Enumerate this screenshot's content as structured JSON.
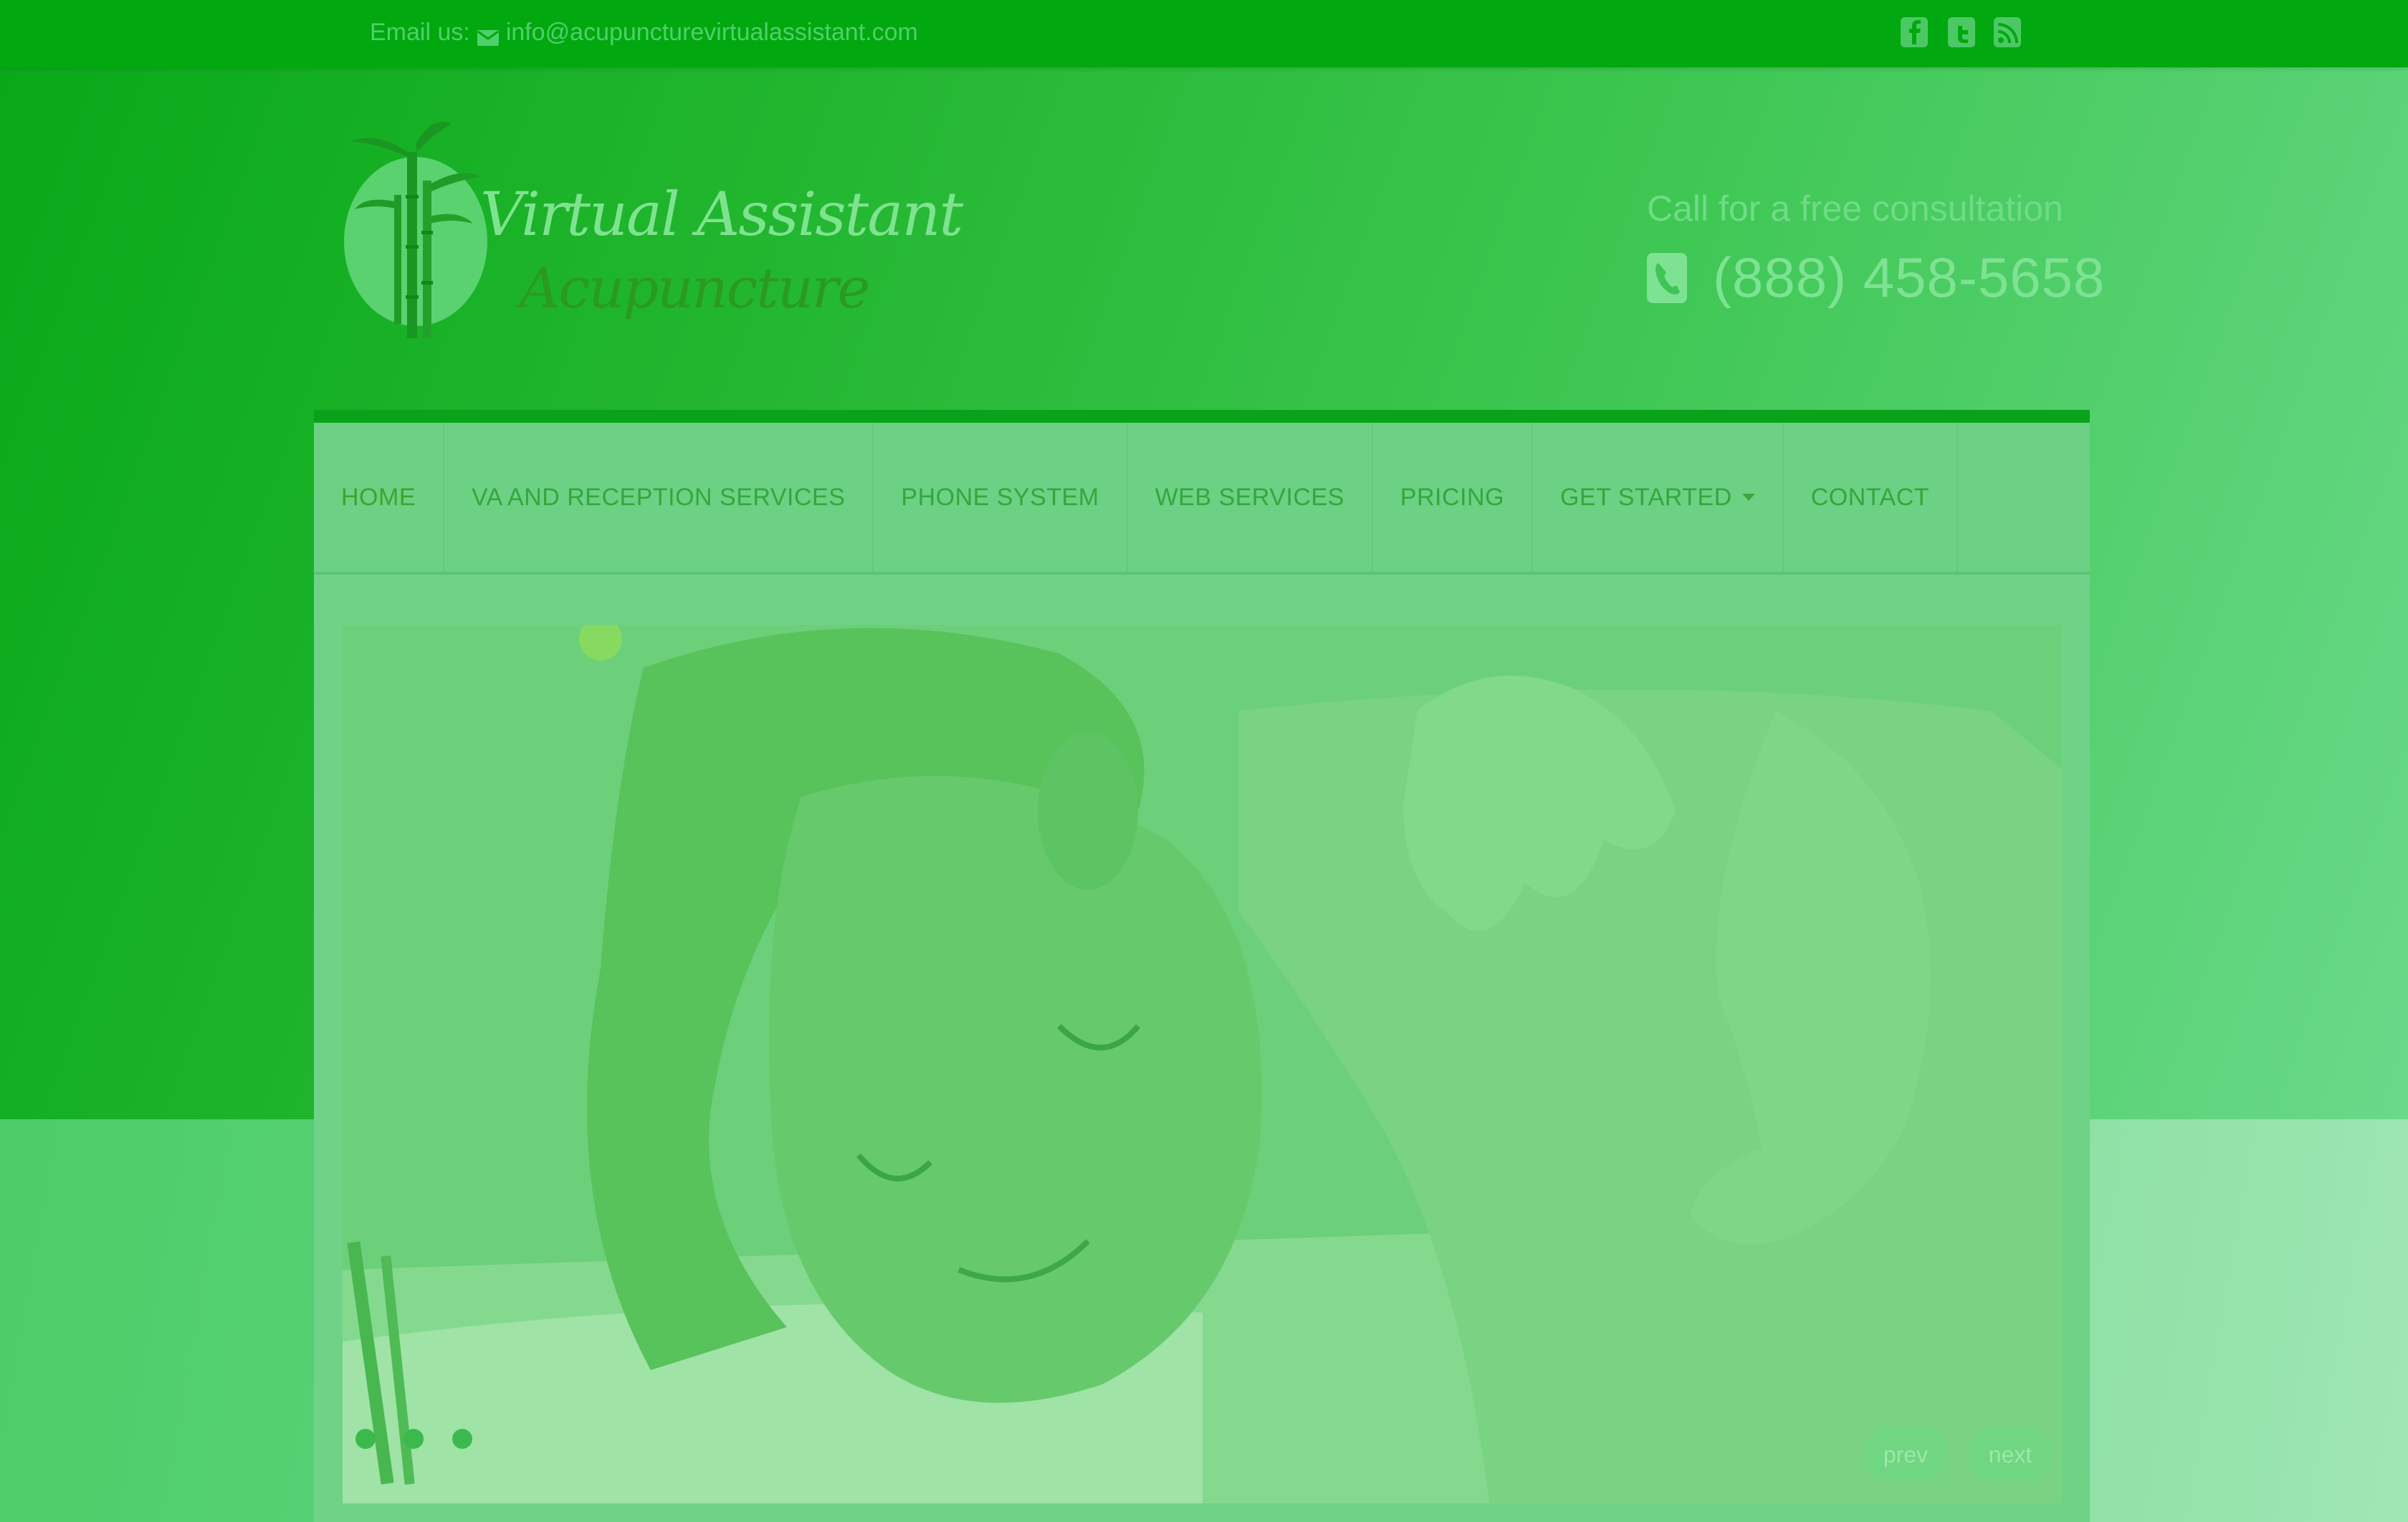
{
  "topbar": {
    "email_label": "Email us:",
    "email_address": "info@acupuncturevirtualassistant.com",
    "social_icons": [
      "facebook-icon",
      "twitter-icon",
      "rss-icon"
    ]
  },
  "header": {
    "logo_line_1": "Virtual Assistant",
    "logo_line_2": "Acupuncture",
    "call_label": "Call for a free consultation",
    "phone_number": "(888) 458-5658"
  },
  "nav": {
    "items": [
      {
        "label": "HOME"
      },
      {
        "label": "VA AND RECEPTION SERVICES"
      },
      {
        "label": "PHONE SYSTEM"
      },
      {
        "label": "WEB SERVICES"
      },
      {
        "label": "PRICING"
      },
      {
        "label": "GET STARTED"
      },
      {
        "label": "CONTACT"
      }
    ]
  },
  "slider": {
    "slide_count": 3,
    "prev_label": "prev",
    "next_label": "next"
  },
  "colors": {
    "topbar": "#02a80f",
    "nav_background": "#6cd184",
    "accent": "#0aa21a",
    "nav_text": "#33a73c"
  }
}
